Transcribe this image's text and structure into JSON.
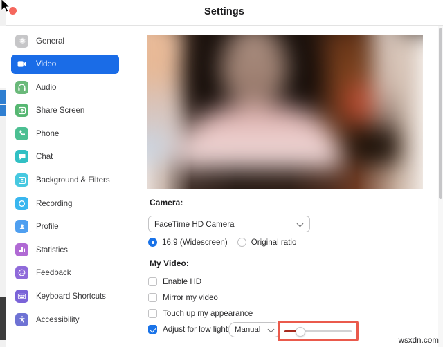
{
  "window": {
    "title": "Settings",
    "close_button_label": "Close",
    "close_color": "#f5675d"
  },
  "cursor": {
    "name": "pointer-arrow"
  },
  "sidebar": {
    "items": [
      {
        "label": "General",
        "icon": "gear-icon",
        "color": "#c6c6c8",
        "active": false
      },
      {
        "label": "Video",
        "icon": "video-camera-icon",
        "color": "#1a6ce7",
        "active": true
      },
      {
        "label": "Audio",
        "icon": "headphones-icon",
        "color": "#6ab97a",
        "active": false
      },
      {
        "label": "Share Screen",
        "icon": "share-screen-icon",
        "color": "#56b772",
        "active": false
      },
      {
        "label": "Phone",
        "icon": "phone-icon",
        "color": "#4cbf92",
        "active": false
      },
      {
        "label": "Chat",
        "icon": "chat-bubble-icon",
        "color": "#31c0c4",
        "active": false
      },
      {
        "label": "Background & Filters",
        "icon": "person-frame-icon",
        "color": "#46c8e0",
        "active": false
      },
      {
        "label": "Recording",
        "icon": "record-circle-icon",
        "color": "#39b6ef",
        "active": false
      },
      {
        "label": "Profile",
        "icon": "person-icon",
        "color": "#4f9ff0",
        "active": false
      },
      {
        "label": "Statistics",
        "icon": "bar-chart-icon",
        "color": "#b06ad4",
        "active": false
      },
      {
        "label": "Feedback",
        "icon": "smiley-face-icon",
        "color": "#8f6ada",
        "active": false
      },
      {
        "label": "Keyboard Shortcuts",
        "icon": "keyboard-icon",
        "color": "#7a63d8",
        "active": false
      },
      {
        "label": "Accessibility",
        "icon": "accessibility-icon",
        "color": "#6e72d4",
        "active": false
      }
    ]
  },
  "main": {
    "preview": {
      "name": "video-preview",
      "alt": "blurred live camera preview of a person"
    },
    "camera_section": {
      "label": "Camera:",
      "select_value": "FaceTime HD Camera",
      "aspect_ratio": {
        "options": [
          {
            "label": "16:9 (Widescreen)",
            "selected": true
          },
          {
            "label": "Original ratio",
            "selected": false
          }
        ]
      }
    },
    "my_video_section": {
      "label": "My Video:",
      "checkboxes": [
        {
          "label": "Enable HD",
          "checked": false
        },
        {
          "label": "Mirror my video",
          "checked": false
        },
        {
          "label": "Touch up my appearance",
          "checked": false
        },
        {
          "label": "Adjust for low light",
          "checked": true
        }
      ],
      "low_light_mode": "Manual",
      "low_light_slider": {
        "value_percent": 20,
        "min": 0,
        "max": 100,
        "fill_color": "#a82b1e",
        "track_color": "#d2d2d4"
      },
      "highlight_color": "#ea5a4c"
    }
  },
  "watermark": {
    "text": "wsxdn.com"
  }
}
